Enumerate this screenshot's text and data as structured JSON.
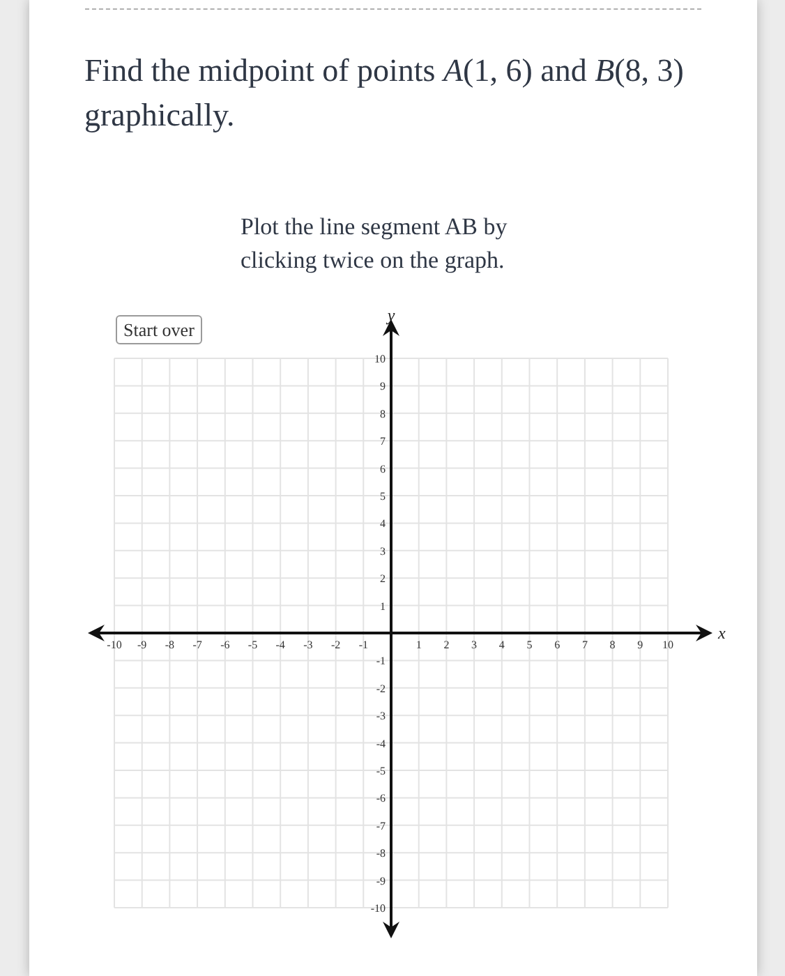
{
  "question": "Find the midpoint of points *A*(1, 6) and *B*(8, 3) graphically.",
  "instruction": "Plot the line segment AB by clicking twice on the graph.",
  "start_over_button": "Start over",
  "graph": {
    "x_axis_label": "x",
    "y_axis_label": "y",
    "x_ticks": [
      "-10",
      "-9",
      "-8",
      "-7",
      "-6",
      "-5",
      "-4",
      "-3",
      "-2",
      "-1",
      "1",
      "2",
      "3",
      "4",
      "5",
      "6",
      "7",
      "8",
      "9",
      "10"
    ],
    "y_ticks": [
      "10",
      "9",
      "8",
      "7",
      "6",
      "5",
      "4",
      "3",
      "2",
      "1",
      "-1",
      "-2",
      "-3",
      "-4",
      "-5",
      "-6",
      "-7",
      "-8",
      "-9",
      "-10"
    ]
  }
}
